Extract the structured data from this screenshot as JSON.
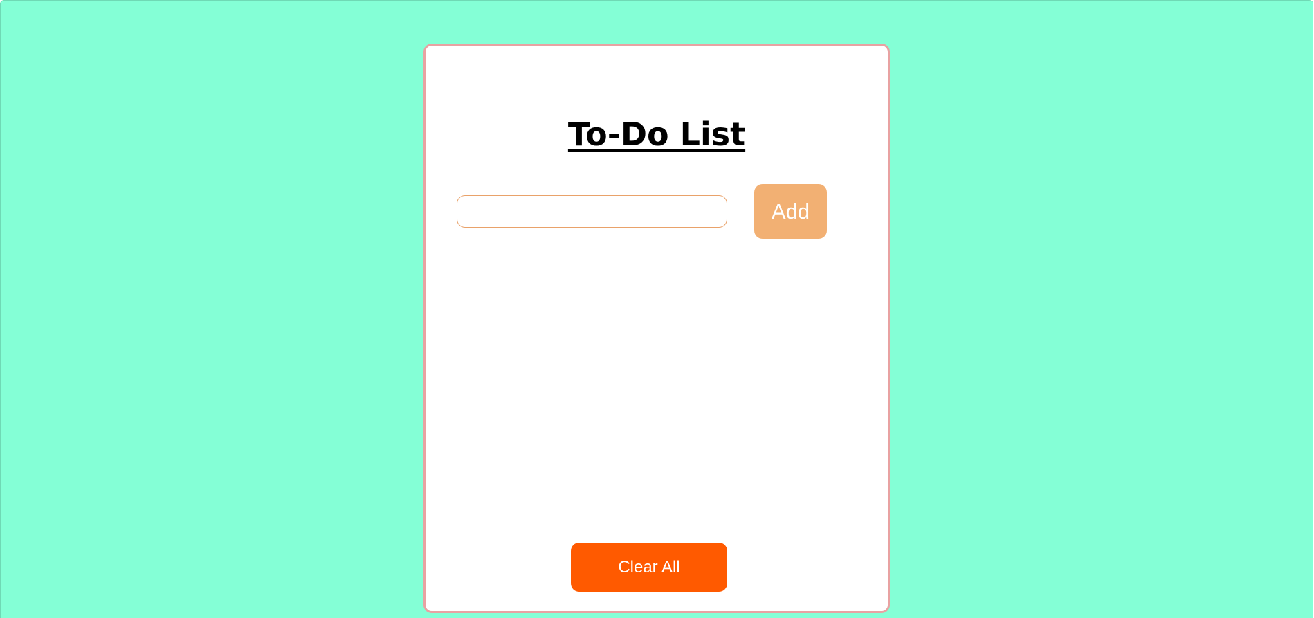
{
  "app": {
    "title": "To-Do List"
  },
  "input": {
    "value": "",
    "placeholder": ""
  },
  "buttons": {
    "add_label": "Add",
    "clear_all_label": "Clear All"
  },
  "tasks": [],
  "colors": {
    "page_background": "#84ffd6",
    "card_background": "#ffffff",
    "card_border": "#e8a2a2",
    "add_button": "#f2b073",
    "clear_button": "#ff5a00",
    "input_border": "#e9a26a"
  }
}
